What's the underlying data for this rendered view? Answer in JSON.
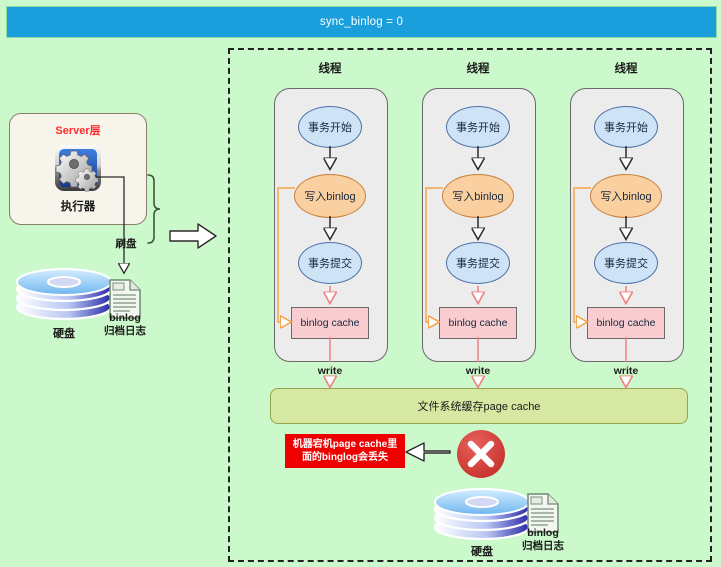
{
  "header": {
    "title": "sync_binlog = 0"
  },
  "colors": {
    "background": "#ccf9cc",
    "header_bar": "#1b9fdc",
    "server_box_fill": "#f7f4ec",
    "server_title": "#ff2d2d",
    "thread_box_fill": "#ececec",
    "ellipse_blue_fill": "#cfe3f7",
    "ellipse_orange_fill": "#fbd0a0",
    "cache_box_fill": "#f9ccd0",
    "page_cache_fill": "#d6e8a1",
    "warning_fill": "#ee0000",
    "error_circle": "#d93a35",
    "orange_arrow": "#f5a142",
    "pink_arrow": "#f08080"
  },
  "left_panel": {
    "server_box": {
      "title": "Server层",
      "icon": "gears-executor-icon",
      "icon_label": "执行器"
    },
    "flush_label": "刷盘",
    "disk": {
      "icon": "hard-disk-icon",
      "label": "硬盘"
    },
    "binlog_doc": {
      "icon": "document-icon",
      "label_line1": "binlog",
      "label_line2": "归档日志"
    },
    "transition_arrow": "block-arrow-right-icon"
  },
  "threads": [
    {
      "title": "线程",
      "nodes": {
        "start": "事务开始",
        "write_binlog": "写入binlog",
        "commit": "事务提交",
        "cache": "binlog cache"
      },
      "write_label": "write"
    },
    {
      "title": "线程",
      "nodes": {
        "start": "事务开始",
        "write_binlog": "写入binlog",
        "commit": "事务提交",
        "cache": "binlog cache"
      },
      "write_label": "write"
    },
    {
      "title": "线程",
      "nodes": {
        "start": "事务开始",
        "write_binlog": "写入binlog",
        "commit": "事务提交",
        "cache": "binlog cache"
      },
      "write_label": "write"
    }
  ],
  "page_cache": {
    "label": "文件系统缓存page cache"
  },
  "warning": {
    "text": "机器宕机page cache里面的binglog会丢失",
    "icon": "error-x-circle-icon",
    "arrow": "block-arrow-left-icon"
  },
  "bottom_storage": {
    "disk": {
      "icon": "hard-disk-icon",
      "label": "硬盘"
    },
    "binlog_doc": {
      "icon": "document-icon",
      "label_line1": "binlog",
      "label_line2": "归档日志"
    }
  }
}
